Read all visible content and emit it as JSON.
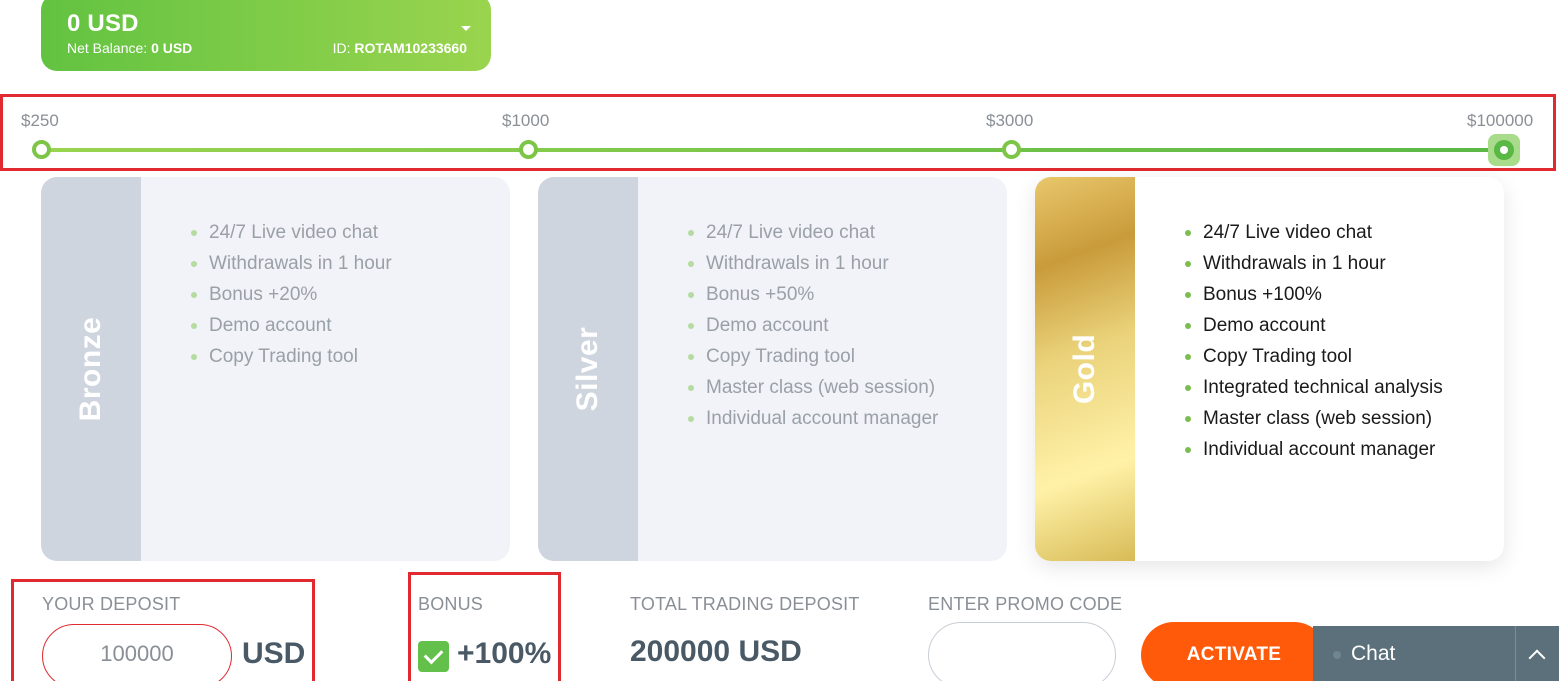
{
  "balance": {
    "amount": "0 USD",
    "net_label": "Net Balance:",
    "net_value": "0 USD",
    "id_label": "ID:",
    "id_value": "ROTAM10233660"
  },
  "slider": {
    "stops": [
      "$250",
      "$1000",
      "$3000",
      "$100000"
    ],
    "selected": "$100000"
  },
  "plans": [
    {
      "name": "Bronze",
      "features": [
        "24/7 Live video chat",
        "Withdrawals in 1 hour",
        "Bonus +20%",
        "Demo account",
        "Copy Trading tool"
      ]
    },
    {
      "name": "Silver",
      "features": [
        "24/7 Live video chat",
        "Withdrawals in 1 hour",
        "Bonus +50%",
        "Demo account",
        "Copy Trading tool",
        "Master class (web session)",
        "Individual account manager"
      ]
    },
    {
      "name": "Gold",
      "features": [
        "24/7 Live video chat",
        "Withdrawals in 1 hour",
        "Bonus +100%",
        "Demo account",
        "Copy Trading tool",
        "Integrated technical analysis",
        "Master class (web session)",
        "Individual account manager"
      ]
    }
  ],
  "deposit": {
    "label": "YOUR DEPOSIT",
    "value": "100000",
    "unit": "USD"
  },
  "bonus": {
    "label": "BONUS",
    "value": "+100%",
    "checked": true
  },
  "total": {
    "label": "TOTAL TRADING DEPOSIT",
    "value": "200000 USD"
  },
  "promo": {
    "label": "ENTER PROMO CODE",
    "value": ""
  },
  "activate_label": "ACTIVATE",
  "chat_label": "Chat",
  "colors": {
    "accent_green": "#62c341",
    "activate_orange": "#ff5a0a",
    "highlight_red": "#e02a2f",
    "text_dark": "#4a5966"
  }
}
